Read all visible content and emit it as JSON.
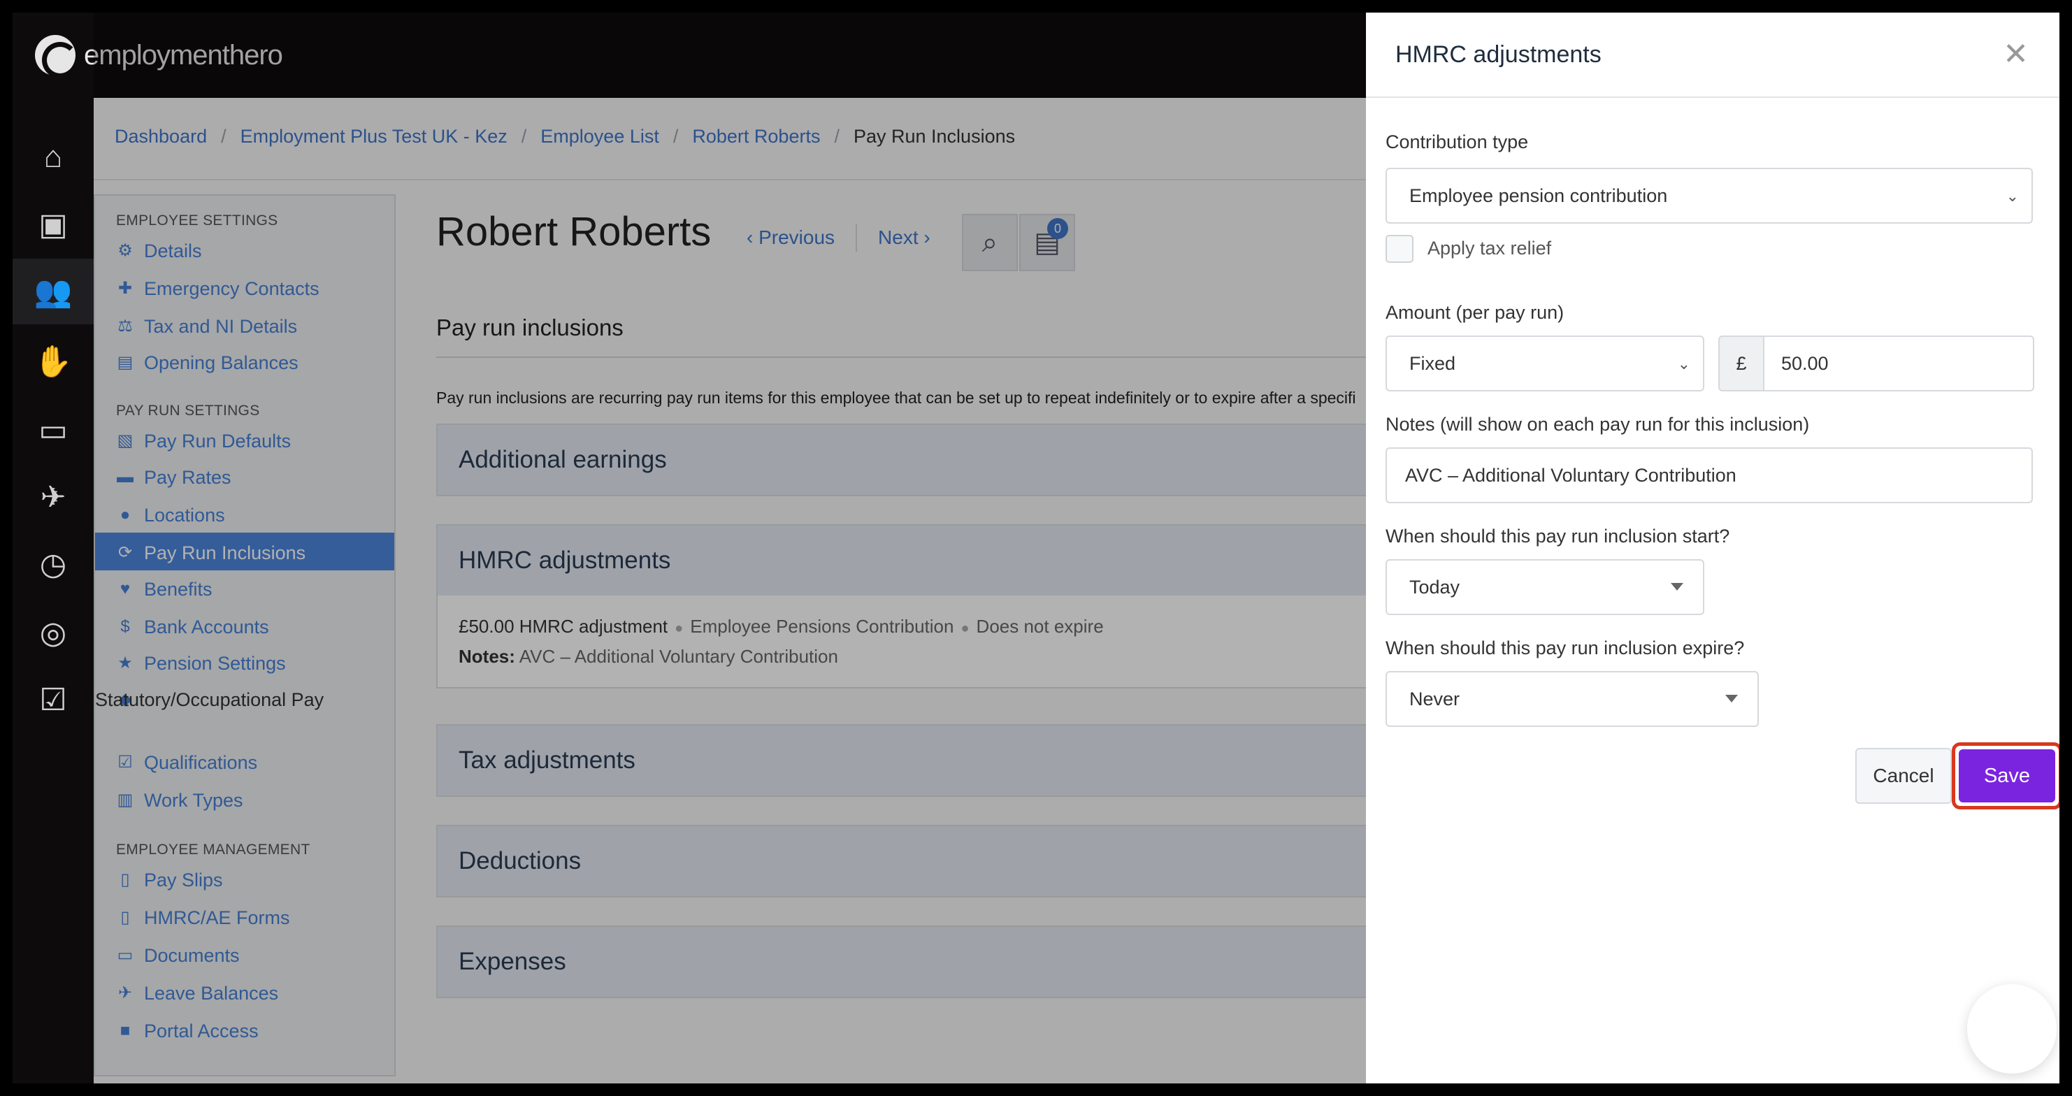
{
  "app": {
    "logo_text": "employmenthero"
  },
  "rail": {
    "icons": [
      {
        "name": "home-icon",
        "glyph": "⌂"
      },
      {
        "name": "briefcase-icon",
        "glyph": "▣"
      },
      {
        "name": "people-icon",
        "glyph": "👥"
      },
      {
        "name": "hand-coin-icon",
        "glyph": "✋"
      },
      {
        "name": "folder-icon",
        "glyph": "▭"
      },
      {
        "name": "plane-icon",
        "glyph": "✈"
      },
      {
        "name": "clock-icon",
        "glyph": "◷"
      },
      {
        "name": "coins-icon",
        "glyph": "◎"
      },
      {
        "name": "clipboard-check-icon",
        "glyph": "☑"
      }
    ]
  },
  "breadcrumb": {
    "items": [
      "Dashboard",
      "Employment Plus Test UK - Kez",
      "Employee List",
      "Robert Roberts"
    ],
    "current": "Pay Run Inclusions"
  },
  "leftnav": {
    "employee_settings": "EMPLOYEE SETTINGS",
    "pay_run_settings": "PAY RUN SETTINGS",
    "employee_management": "EMPLOYEE MANAGEMENT",
    "items": [
      "Details",
      "Emergency Contacts",
      "Tax and NI Details",
      "Opening Balances",
      "Pay Run Defaults",
      "Pay Rates",
      "Locations",
      "Pay Run Inclusions",
      "Benefits",
      "Bank Accounts",
      "Pension Settings",
      "Statutory/Occupational Pay",
      "Qualifications",
      "Work Types",
      "Pay Slips",
      "HMRC/AE Forms",
      "Documents",
      "Leave Balances",
      "Portal Access"
    ]
  },
  "employee": {
    "name": "Robert Roberts",
    "previous": "Previous",
    "next": "Next",
    "notes_count": "0"
  },
  "inclusions": {
    "title": "Pay run inclusions",
    "intro": "Pay run inclusions are recurring pay run items for this employee that can be set up to repeat indefinitely or to expire after a specifi",
    "panels": {
      "additional_earnings": "Additional earnings",
      "hmrc": "HMRC adjustments",
      "tax": "Tax adjustments",
      "deductions": "Deductions",
      "expenses": "Expenses"
    },
    "hmrc_item": {
      "amount": "£50.00 HMRC adjustment",
      "type": "Employee Pensions Contribution",
      "expiry": "Does not expire",
      "notes_label": "Notes:",
      "notes": "AVC – Additional Voluntary Contribution"
    }
  },
  "drawer": {
    "title": "HMRC adjustments",
    "contribution_label": "Contribution type",
    "contribution_value": "Employee pension contribution",
    "tax_relief_label": "Apply tax relief",
    "amount_label": "Amount (per pay run)",
    "amount_type": "Fixed",
    "currency": "£",
    "amount_value": "50.00",
    "notes_label": "Notes (will show on each pay run for this inclusion)",
    "notes_value": "AVC – Additional Voluntary Contribution",
    "start_label": "When should this pay run inclusion start?",
    "start_value": "Today",
    "expire_label": "When should this pay run inclusion expire?",
    "expire_value": "Never",
    "cancel": "Cancel",
    "save": "Save"
  },
  "colors": {
    "accent": "#7b24e0",
    "highlight": "#d8381e",
    "link": "#3f74c7",
    "nav_active": "#4d86dc"
  }
}
